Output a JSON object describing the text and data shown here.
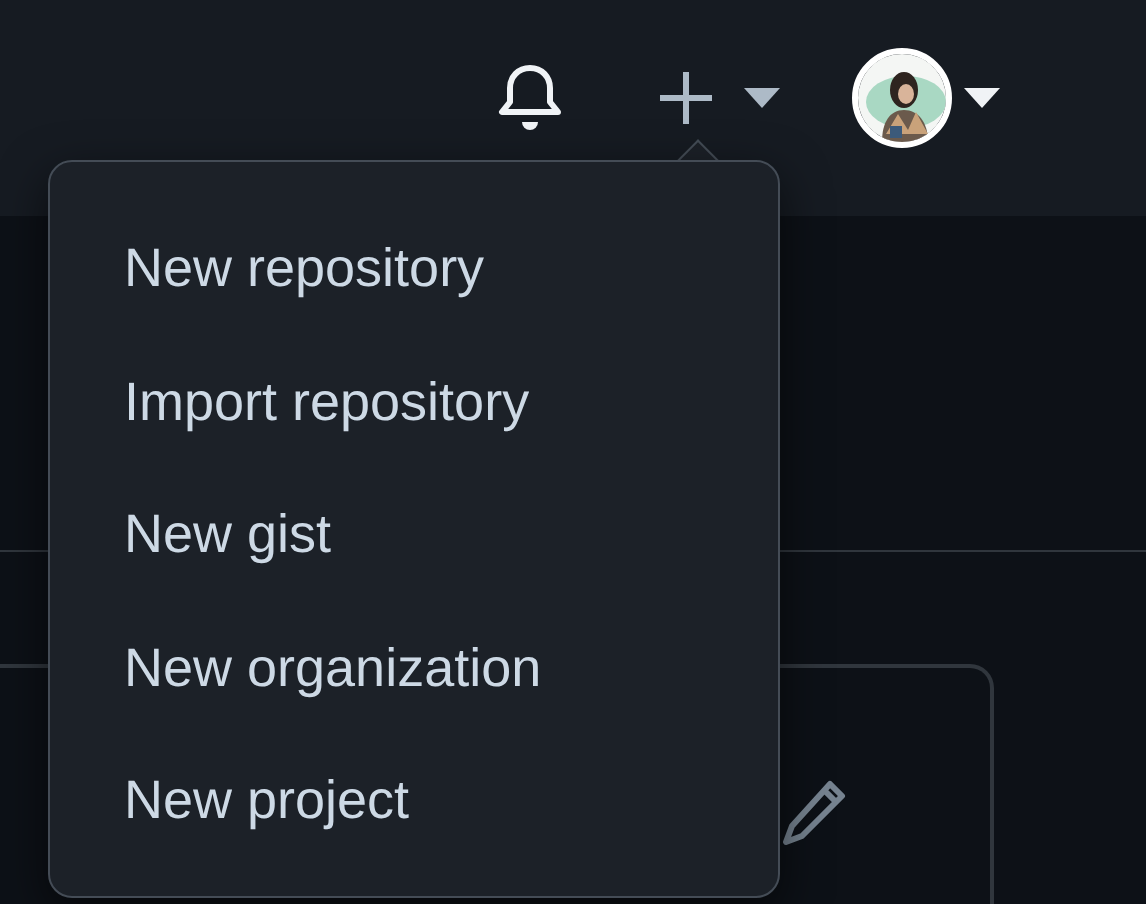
{
  "menu": {
    "items": [
      {
        "label": "New repository"
      },
      {
        "label": "Import repository"
      },
      {
        "label": "New gist"
      },
      {
        "label": "New organization"
      },
      {
        "label": "New project"
      }
    ]
  }
}
